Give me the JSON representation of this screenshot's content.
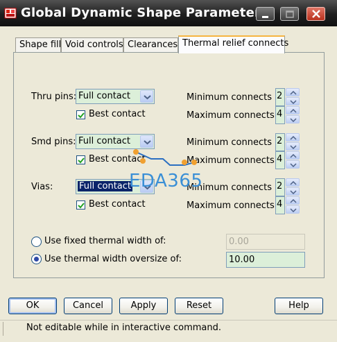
{
  "window": {
    "title": "Global Dynamic Shape Parameters"
  },
  "tabs": [
    {
      "label": "Shape fill"
    },
    {
      "label": "Void controls"
    },
    {
      "label": "Clearances"
    },
    {
      "label": "Thermal relief connects"
    }
  ],
  "thru_pins": {
    "label": "Thru pins:",
    "combo_value": "Full contact",
    "best_contact_label": "Best contact",
    "best_contact_checked": true,
    "min_label": "Minimum connects",
    "min_value": "2",
    "max_label": "Maximum connects",
    "max_value": "4"
  },
  "smd_pins": {
    "label": "Smd pins:",
    "combo_value": "Full contact",
    "best_contact_label": "Best contact",
    "best_contact_checked": true,
    "min_label": "Minimum connects",
    "min_value": "2",
    "max_label": "Maximum connects",
    "max_value": "4"
  },
  "vias": {
    "label": "Vias:",
    "combo_value": "Full contact",
    "best_contact_label": "Best contact",
    "best_contact_checked": true,
    "min_label": "Minimum connects",
    "min_value": "2",
    "max_label": "Maximum connects",
    "max_value": "4"
  },
  "thermal_width": {
    "fixed_label": "Use fixed thermal width of:",
    "fixed_value": "0.00",
    "oversize_label": "Use thermal width oversize of:",
    "oversize_value": "10.00",
    "selected": "oversize"
  },
  "buttons": {
    "ok": "OK",
    "cancel": "Cancel",
    "apply": "Apply",
    "reset": "Reset",
    "help": "Help"
  },
  "status": {
    "message": "Not editable while in interactive command."
  },
  "watermark": {
    "text": "EDA365"
  },
  "colors": {
    "field_bg": "#dcefd9",
    "active_tab_accent": "#f6b440",
    "watermark": "#3a8fd6",
    "title_bar": "#1f1f1f"
  }
}
